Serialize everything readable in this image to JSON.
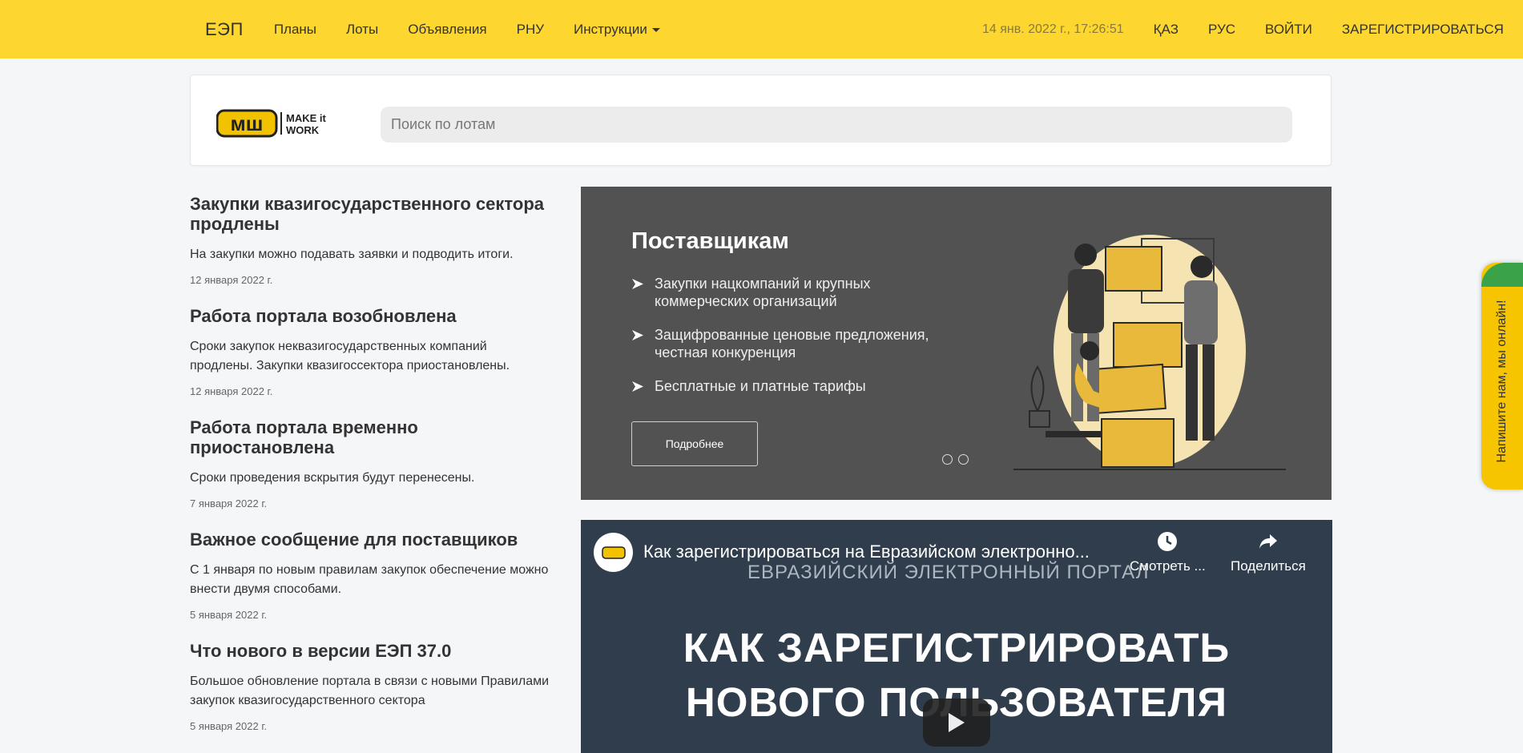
{
  "nav": {
    "brand": "ЕЭП",
    "links": [
      "Планы",
      "Лоты",
      "Объявления",
      "РНУ",
      "Инструкции"
    ],
    "datetime": "14 янв. 2022 г., 17:26:51",
    "lang_kz": "ҚАЗ",
    "lang_ru": "РУС",
    "login": "ВОЙТИ",
    "register": "ЗАРЕГИСТРИРОВАТЬСЯ"
  },
  "search": {
    "placeholder": "Поиск по лотам"
  },
  "logo": {
    "mark": "мш",
    "text_line1": "MAKE it",
    "text_line2": "WORK"
  },
  "news": [
    {
      "title": "Закупки квазигосударственного сектора продлены",
      "text": "На закупки можно подавать заявки и подводить итоги.",
      "date": "12 января 2022 г."
    },
    {
      "title": "Работа портала возобновлена",
      "text": "Сроки закупок неквазигосударственных компаний продлены. Закупки квазигоссектора приостановлены.",
      "date": "12 января 2022 г."
    },
    {
      "title": "Работа портала временно приостановлена",
      "text": "Сроки проведения вскрытия будут перенесены.",
      "date": "7 января 2022 г."
    },
    {
      "title": "Важное сообщение для поставщиков",
      "text": "С 1 января по новым правилам закупок обеспечение можно внести двумя способами.",
      "date": "5 января 2022 г."
    },
    {
      "title": "Что нового в версии ЕЭП 37.0",
      "text": "Большое обновление портала в связи с новыми Правилами закупок квазигосударственного сектора",
      "date": "5 января 2022 г."
    }
  ],
  "banner": {
    "title": "Поставщикам",
    "items": [
      "Закупки нацкомпаний и крупных коммерческих организаций",
      "Защифрованные ценовые предложения, честная конкуренция",
      "Бесплатные и платные тарифы"
    ],
    "button": "Подробнее",
    "slides": 2
  },
  "video": {
    "title": "Как зарегистрироваться на Евразийском электронно...",
    "watermark": "ЕВРАЗИЙСКИЙ ЭЛЕКТРОННЫЙ ПОРТАЛ",
    "watch_label": "Смотреть ...",
    "share_label": "Поделиться",
    "big_line1": "КАК ЗАРЕГИСТРИРОВАТЬ",
    "big_line2": "НОВОГО ПОЛЬЗОВАТЕЛЯ"
  },
  "chat": {
    "label": "Напишите нам, мы онлайн!"
  },
  "colors": {
    "topbar": "#fdd630",
    "banner_bg": "#525252",
    "video_bg": "#2f3d4d",
    "chat_bg": "#f7c500",
    "chat_leaf": "#3aa34a"
  }
}
